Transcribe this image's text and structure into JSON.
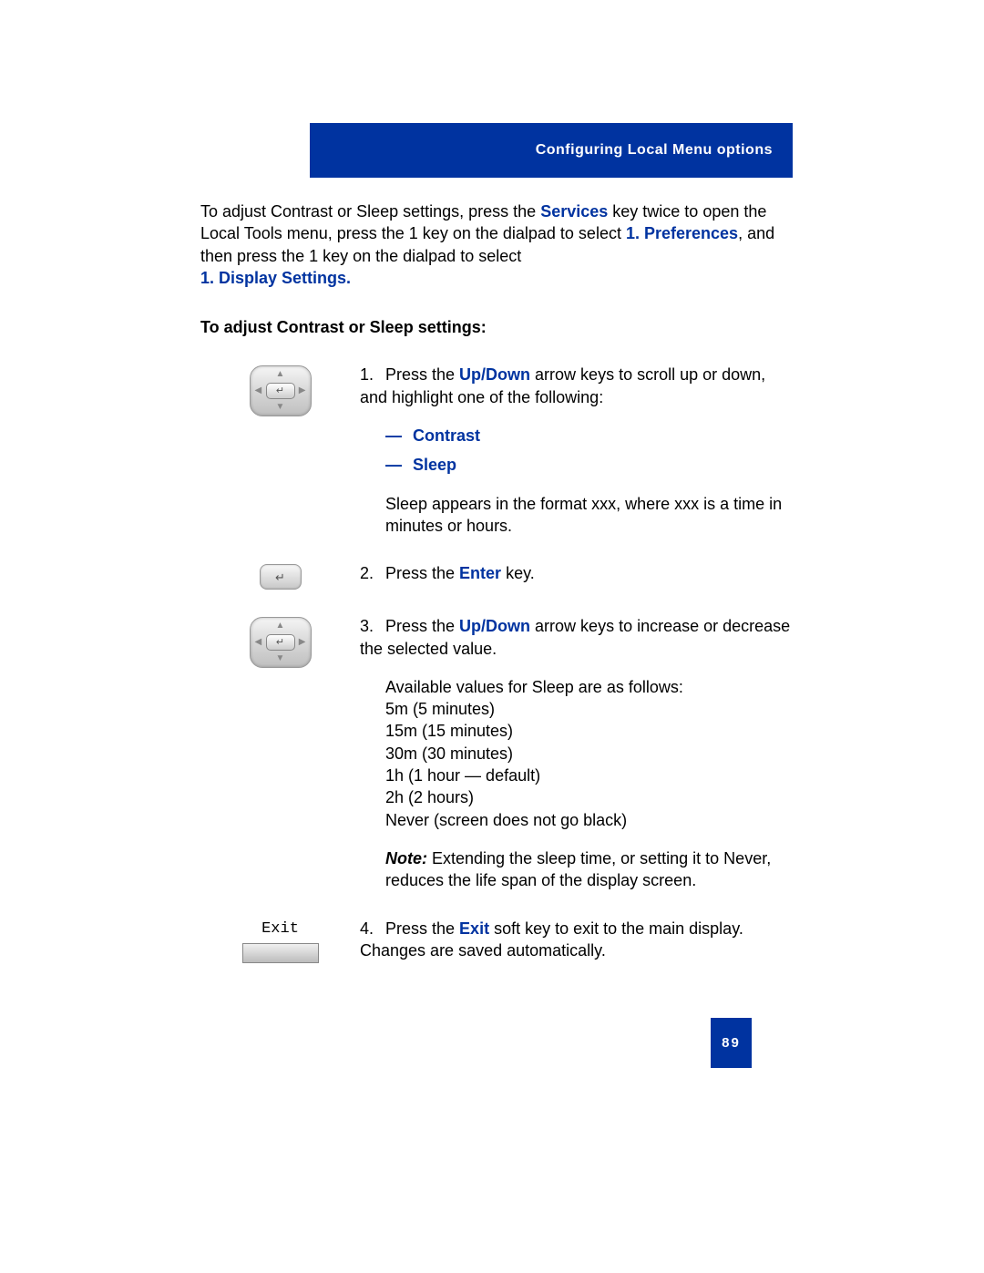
{
  "header": {
    "title": "Configuring Local Menu options"
  },
  "intro": {
    "l1_a": "To adjust Contrast or Sleep settings, press the ",
    "services": "Services",
    "l1_b": " key twice to open the Local Tools menu, press the 1 key on the dialpad to select ",
    "pref": "1. Preferences",
    "l1_c": ", and then press the 1 key on the dialpad to select ",
    "disp": "1. Display Settings."
  },
  "sub_heading": "To adjust Contrast or Sleep settings:",
  "step1": {
    "num": "1.",
    "p1a": "Press the ",
    "updown": "Up/Down",
    "p1b": " arrow keys to scroll up or down, and highlight one of the following:",
    "opt_dash": "—",
    "opt1": "Contrast",
    "opt2": "Sleep",
    "p2": "Sleep appears in the format xxx, where xxx is a time in minutes or hours."
  },
  "step2": {
    "num": "2.",
    "a": "Press the ",
    "enter": "Enter",
    "b": " key."
  },
  "step3": {
    "num": "3.",
    "p1a": "Press the ",
    "updown": "Up/Down",
    "p1b": " arrow keys to increase or decrease the selected value.",
    "p2": "Available values for Sleep are as follows:",
    "v1": "5m (5 minutes)",
    "v2": "15m (15 minutes)",
    "v3": "30m (30 minutes)",
    "v4": "1h (1 hour — default)",
    "v5": "2h (2 hours)",
    "v6": "Never (screen does not go black)",
    "note_label": "Note:",
    "note_text": " Extending the sleep time, or setting it to Never, reduces the life span of the display screen."
  },
  "step4": {
    "num": "4.",
    "a": "Press the ",
    "exit": "Exit",
    "b": " soft key to exit to the main display. Changes are saved automatically.",
    "btn_label": "Exit"
  },
  "page_number": "89"
}
